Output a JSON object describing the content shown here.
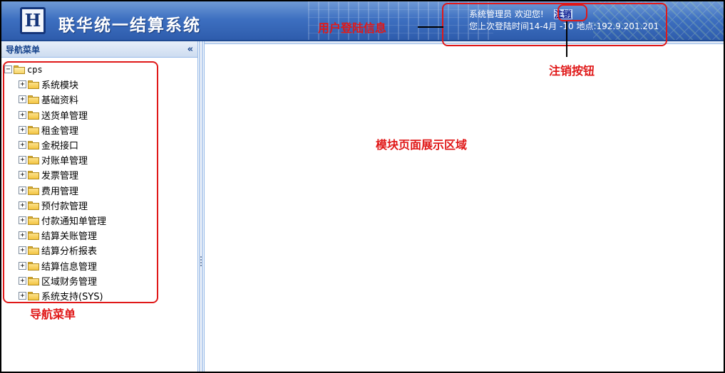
{
  "header": {
    "logo_glyph": "H",
    "app_title": "联华统一结算系统",
    "welcome_text": "系统管理员 欢迎您!",
    "logout_label": "注销",
    "last_login_text": "您上次登陆时间14-4月 -10 地点:192.9.201.201"
  },
  "nav": {
    "title": "导航菜单",
    "collapse_glyph": "«",
    "root": {
      "label": "cps",
      "expander": "−",
      "icon": "folder-open-icon"
    },
    "items": [
      {
        "label": "系统模块",
        "expander": "+",
        "icon": "folder-icon"
      },
      {
        "label": "基础资料",
        "expander": "+",
        "icon": "folder-icon"
      },
      {
        "label": "送货单管理",
        "expander": "+",
        "icon": "folder-icon"
      },
      {
        "label": "租金管理",
        "expander": "+",
        "icon": "folder-icon"
      },
      {
        "label": "金税接口",
        "expander": "+",
        "icon": "folder-icon"
      },
      {
        "label": "对账单管理",
        "expander": "+",
        "icon": "folder-icon"
      },
      {
        "label": "发票管理",
        "expander": "+",
        "icon": "folder-icon"
      },
      {
        "label": "费用管理",
        "expander": "+",
        "icon": "folder-icon"
      },
      {
        "label": "预付款管理",
        "expander": "+",
        "icon": "folder-icon"
      },
      {
        "label": "付款通知单管理",
        "expander": "+",
        "icon": "folder-icon"
      },
      {
        "label": "结算关账管理",
        "expander": "+",
        "icon": "folder-icon"
      },
      {
        "label": "结算分析报表",
        "expander": "+",
        "icon": "folder-icon"
      },
      {
        "label": "结算信息管理",
        "expander": "+",
        "icon": "folder-icon"
      },
      {
        "label": "区域财务管理",
        "expander": "+",
        "icon": "folder-icon"
      },
      {
        "label": "系统支持(SYS)",
        "expander": "+",
        "icon": "folder-icon"
      }
    ]
  },
  "annotations": {
    "user_info": "用户登陆信息",
    "logout_button": "注销按钮",
    "module_area": "模块页面展示区域",
    "nav_menu": "导航菜单"
  },
  "colors": {
    "header_blue": "#3d6fc0",
    "annotation_red": "#e01818",
    "panel_border": "#99bbe8"
  }
}
